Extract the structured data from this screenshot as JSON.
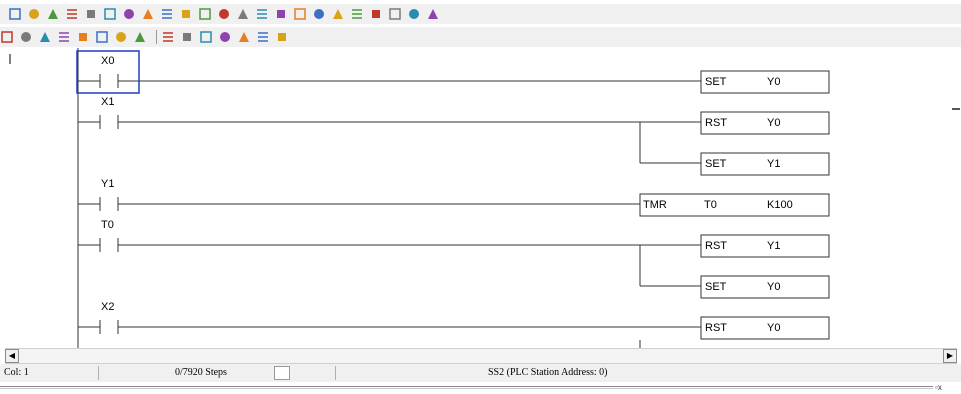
{
  "toolbar_row1": {
    "icons": [
      "pencil-icon",
      "stop-icon",
      "stop-icon",
      "circle-icon",
      "table-icon",
      "grid-icon",
      "window-icon",
      "run-icon",
      "stop-red-icon",
      "monitor-icon",
      "monitor-edit-icon",
      "tools-icon",
      "convert-icon",
      "compile-icon",
      "compile-icon",
      "compile-icon",
      "document-icon",
      "document-icon",
      "image-icon",
      "zoom-in-icon",
      "zoom-out-icon",
      "network-icon",
      "align-icon"
    ]
  },
  "toolbar_row2": {
    "icons": [
      "contact-no-icon",
      "contact-nc-icon",
      "rising-edge-icon",
      "falling-edge-icon",
      "coil-icon",
      "set-coil-icon",
      "reset-coil-icon",
      "instruction-icon",
      "hline-icon",
      "vline-icon",
      "delete-icon",
      "insert-icon",
      "delete-row-icon",
      "block-icon",
      "comment-icon"
    ]
  },
  "ladder": {
    "rungs": [
      {
        "contact": "X0",
        "outputs": [
          {
            "op": "SET",
            "arg1": "Y0",
            "arg2": ""
          }
        ]
      },
      {
        "contact": "X1",
        "outputs": [
          {
            "op": "RST",
            "arg1": "Y0",
            "arg2": ""
          },
          {
            "op": "SET",
            "arg1": "Y1",
            "arg2": ""
          }
        ]
      },
      {
        "contact": "Y1",
        "outputs": [
          {
            "op": "TMR",
            "arg1": "T0",
            "arg2": "K100"
          }
        ]
      },
      {
        "contact": "T0",
        "outputs": [
          {
            "op": "RST",
            "arg1": "Y1",
            "arg2": ""
          },
          {
            "op": "SET",
            "arg1": "Y0",
            "arg2": ""
          }
        ]
      },
      {
        "contact": "X2",
        "outputs": [
          {
            "op": "RST",
            "arg1": "Y0",
            "arg2": ""
          }
        ]
      }
    ],
    "cursor_on": "X0"
  },
  "status": {
    "col": "Col: 1",
    "steps": "0/7920 Steps",
    "station": "SS2 (PLC Station Address: 0)"
  },
  "colors": {
    "toolbar_bg": "#f0f0f0",
    "cursor": "#1f3fbf",
    "line": "#333333"
  }
}
